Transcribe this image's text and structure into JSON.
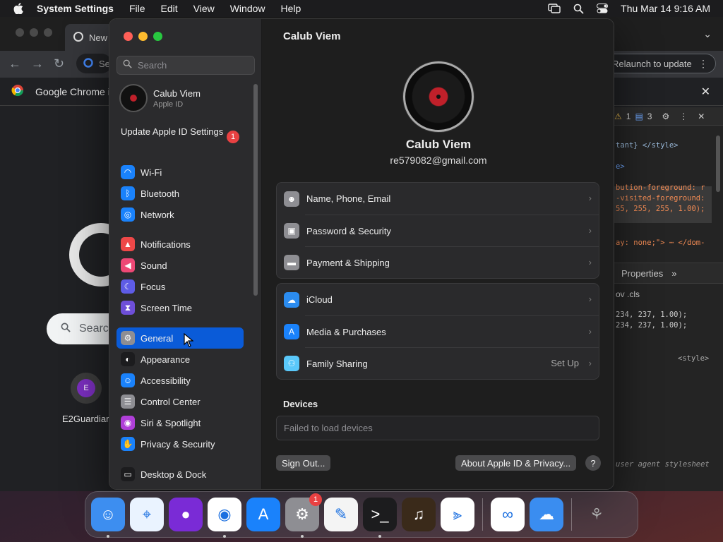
{
  "menubar": {
    "app_name": "System Settings",
    "menus": [
      "File",
      "Edit",
      "View",
      "Window",
      "Help"
    ],
    "clock": "Thu Mar 14  9:16 AM"
  },
  "chrome": {
    "tab_title": "New",
    "omnibox_text": "Se",
    "relaunch_label": "Relaunch to update",
    "infobar_text": "Google Chrome i",
    "search_text": "Searc",
    "shortcut_letter": "E",
    "shortcut_label": "E2Guardiar",
    "devtools": {
      "warn_count": "1",
      "msg_count": "3",
      "lines": [
        "tant} </style>",
        "e>",
        "bution-foreground: r",
        "-visited-foreground:",
        "55, 255, 255, 1.00);",
        "ay: none;\"> ⋯ </dom-"
      ],
      "properties_tab": "Properties",
      "styles_toolbar": "ov  .cls",
      "style_lines": [
        "234, 237, 1.00);",
        " 234, 237, 1.00);"
      ],
      "style_tag": "<style>",
      "ua_label": "user agent stylesheet"
    }
  },
  "settings": {
    "search_placeholder": "Search",
    "account": {
      "name": "Calub Viem",
      "sub": "Apple ID"
    },
    "update": {
      "label": "Update Apple ID Settings",
      "badge": "1"
    },
    "sidebar_groups": [
      [
        {
          "label": "Wi-Fi",
          "icon": "wifi-icon",
          "color": "#1a82fb",
          "glyph": "◠"
        },
        {
          "label": "Bluetooth",
          "icon": "bluetooth-icon",
          "color": "#1a82fb",
          "glyph": "ᛒ"
        },
        {
          "label": "Network",
          "icon": "globe-icon",
          "color": "#1a82fb",
          "glyph": "◎"
        }
      ],
      [
        {
          "label": "Notifications",
          "icon": "bell-icon",
          "color": "#ee4848",
          "glyph": "▲"
        },
        {
          "label": "Sound",
          "icon": "speaker-icon",
          "color": "#ee4875",
          "glyph": "◀"
        },
        {
          "label": "Focus",
          "icon": "moon-icon",
          "color": "#5e5ce6",
          "glyph": "☾"
        },
        {
          "label": "Screen Time",
          "icon": "hourglass-icon",
          "color": "#6e4fd8",
          "glyph": "⧗"
        }
      ],
      [
        {
          "label": "General",
          "icon": "gear-icon",
          "color": "#8e8e93",
          "glyph": "⚙",
          "active": true
        },
        {
          "label": "Appearance",
          "icon": "appearance-icon",
          "color": "#1c1c1e",
          "glyph": "◐"
        },
        {
          "label": "Accessibility",
          "icon": "accessibility-icon",
          "color": "#1a82fb",
          "glyph": "☺"
        },
        {
          "label": "Control Center",
          "icon": "control-center-icon",
          "color": "#8e8e93",
          "glyph": "☰"
        },
        {
          "label": "Siri & Spotlight",
          "icon": "siri-icon",
          "color": "#b03fd8",
          "glyph": "◉"
        },
        {
          "label": "Privacy & Security",
          "icon": "hand-icon",
          "color": "#1a82fb",
          "glyph": "✋"
        }
      ],
      [
        {
          "label": "Desktop & Dock",
          "icon": "dock-icon",
          "color": "#1c1c1e",
          "glyph": "▭"
        }
      ]
    ],
    "main": {
      "title": "Calub Viem",
      "profile_name": "Calub Viem",
      "email": "re579082@gmail.com",
      "card1": [
        {
          "label": "Name, Phone, Email",
          "icon": "person-card-icon",
          "color": "#8e8e93",
          "glyph": "☻"
        },
        {
          "label": "Password & Security",
          "icon": "lock-icon",
          "color": "#8e8e93",
          "glyph": "▣"
        },
        {
          "label": "Payment & Shipping",
          "icon": "credit-card-icon",
          "color": "#8e8e93",
          "glyph": "▬"
        }
      ],
      "card2": [
        {
          "label": "iCloud",
          "icon": "icloud-icon",
          "color": "#2b8cf0",
          "glyph": "☁"
        },
        {
          "label": "Media & Purchases",
          "icon": "app-store-icon",
          "color": "#1a82fb",
          "glyph": "A"
        },
        {
          "label": "Family Sharing",
          "icon": "family-icon",
          "color": "#5ac8fa",
          "glyph": "⚇",
          "value": "Set Up"
        }
      ],
      "devices_title": "Devices",
      "devices_status": "Failed to load devices",
      "sign_out": "Sign Out...",
      "about": "About Apple ID & Privacy...",
      "help": "?"
    }
  },
  "dock": [
    {
      "name": "finder-icon",
      "color": "#3d8ef0",
      "glyph": "☺",
      "running": true
    },
    {
      "name": "safari-icon",
      "color": "#eaf3ff",
      "glyph": "⌖"
    },
    {
      "name": "firefox-icon",
      "color": "#7a2bd6",
      "glyph": "●"
    },
    {
      "name": "chrome-icon",
      "color": "#ffffff",
      "glyph": "◉",
      "running": true
    },
    {
      "name": "app-store-icon",
      "color": "#1a82fb",
      "glyph": "A"
    },
    {
      "name": "system-settings-icon",
      "color": "#8e8e93",
      "glyph": "⚙",
      "badge": "1",
      "running": true
    },
    {
      "name": "textedit-icon",
      "color": "#f4f4f4",
      "glyph": "✎"
    },
    {
      "name": "terminal-icon",
      "color": "#1c1c1e",
      "glyph": ">_",
      "running": true
    },
    {
      "name": "garageband-icon",
      "color": "#3a2a1a",
      "glyph": "♫"
    },
    {
      "name": "vscode-icon",
      "color": "#ffffff",
      "glyph": "⫸",
      "sep_after": true
    },
    {
      "name": "visual-studio-icon",
      "color": "#ffffff",
      "glyph": "∞"
    },
    {
      "name": "weather-icon",
      "color": "#3a8df0",
      "glyph": "☁",
      "sep_after": true
    },
    {
      "name": "trash-icon",
      "color": "transparent",
      "glyph": "⚘"
    }
  ]
}
